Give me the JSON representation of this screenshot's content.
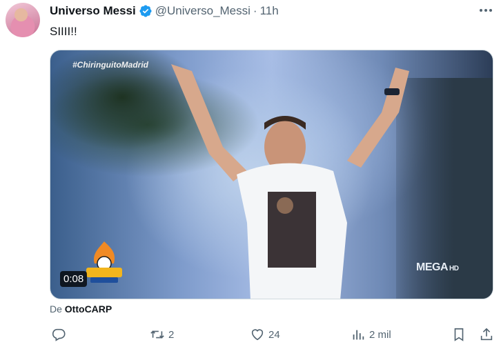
{
  "tweet": {
    "display_name": "Universo Messi",
    "handle": "@Universo_Messi",
    "separator": "·",
    "time": "11h",
    "text": "SIIII!!",
    "verified": true
  },
  "media": {
    "overlay_hashtag": "#ChiringuitoMadrid",
    "duration": "0:08",
    "channel_logo": "MEGA",
    "channel_suffix": "HD",
    "source_prefix": "De",
    "source_name": "OttoCARP"
  },
  "actions": {
    "replies": "",
    "retweets": "2",
    "likes": "24",
    "views": "2 mil"
  },
  "colors": {
    "text_primary": "#0f1419",
    "text_secondary": "#536471",
    "verified_blue": "#1d9bf0",
    "border": "#cfd9de"
  },
  "icons": [
    "avatar",
    "verified-badge-icon",
    "more-icon",
    "reply-icon",
    "retweet-icon",
    "like-icon",
    "views-icon",
    "bookmark-icon",
    "share-icon"
  ]
}
